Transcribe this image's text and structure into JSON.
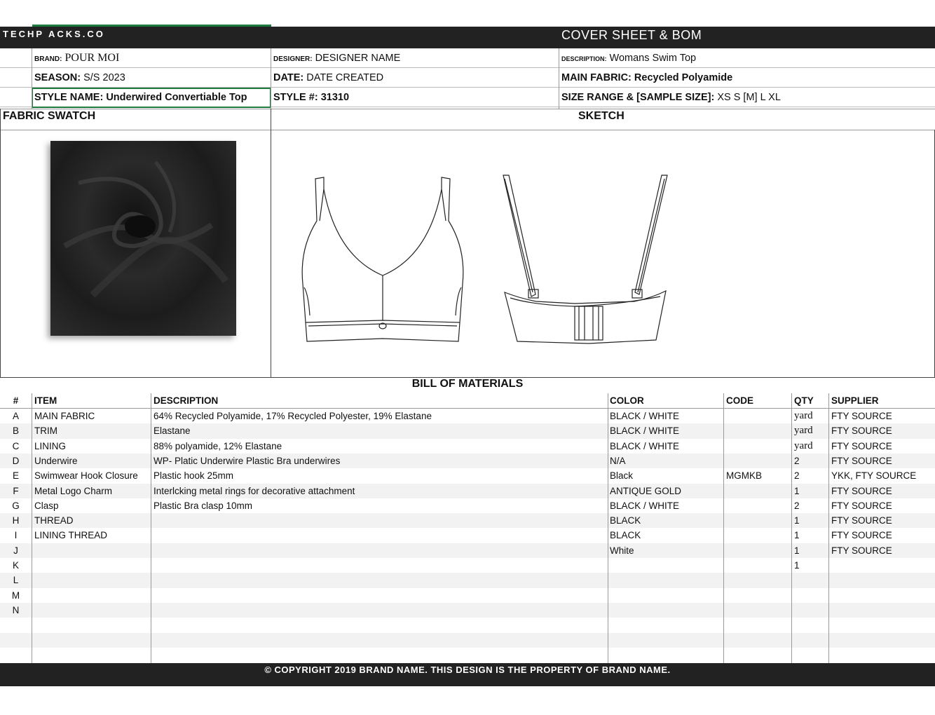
{
  "header": {
    "logo": "TECHP ACKS.CO",
    "title": "COVER  SHEET  &  BOM"
  },
  "info": {
    "brand_label": "BRAND:",
    "brand": "POUR MOI",
    "designer_label": "DESIGNER:",
    "designer": "DESIGNER NAME",
    "description_label": "DESCRIPTION:",
    "description": "Womans Swim Top",
    "season_label": "SEASON:",
    "season": "S/S 2023",
    "date_label": "DATE:",
    "date": "DATE CREATED",
    "main_fabric_label": "MAIN FABRIC:",
    "main_fabric": "Recycled Polyamide",
    "style_name_label": "STYLE NAME:",
    "style_name": "Underwired Convertiable Top",
    "style_no_label": "STYLE #:",
    "style_no": "31310",
    "size_range_label": "SIZE RANGE & [SAMPLE SIZE]:",
    "size_range": "XS  S  [M]  L  XL"
  },
  "sections": {
    "fabric_swatch": "FABRIC SWATCH",
    "sketch": "SKETCH"
  },
  "bom": {
    "title": "BILL OF MATERIALS",
    "columns": [
      "#",
      "ITEM",
      "DESCRIPTION",
      "COLOR",
      "CODE",
      "QTY",
      "SUPPLIER"
    ],
    "rows": [
      {
        "id": "A",
        "item": "MAIN FABRIC",
        "desc": "64% Recycled Polyamide, 17% Recycled Polyester, 19% Elastane",
        "color": "BLACK / WHITE",
        "code": "",
        "qty": "yard",
        "supplier": "FTY SOURCE"
      },
      {
        "id": "B",
        "item": "TRIM",
        "desc": "Elastane",
        "color": "BLACK / WHITE",
        "code": "",
        "qty": "yard",
        "supplier": "FTY SOURCE"
      },
      {
        "id": "C",
        "item": "LINING",
        "desc": "88% polyamide, 12% Elastane",
        "color": "BLACK / WHITE",
        "code": "",
        "qty": "yard",
        "supplier": "FTY SOURCE"
      },
      {
        "id": "D",
        "item": "Underwire",
        "desc": "WP- Platic Underwire Plastic Bra underwires",
        "color": "N/A",
        "code": "",
        "qty": "2",
        "supplier": "FTY SOURCE"
      },
      {
        "id": "E",
        "item": "Swimwear Hook Closure",
        "desc": "Plastic hook  25mm",
        "color": "Black",
        "code": "MGMKB",
        "qty": "2",
        "supplier": "YKK, FTY SOURCE"
      },
      {
        "id": "F",
        "item": "Metal Logo Charm",
        "desc": "Interlcking metal rings for decorative attachment",
        "color": "ANTIQUE GOLD",
        "code": "",
        "qty": "1",
        "supplier": "FTY SOURCE"
      },
      {
        "id": "G",
        "item": "Clasp",
        "desc": "Plastic Bra clasp 10mm",
        "color": "BLACK / WHITE",
        "code": "",
        "qty": "2",
        "supplier": "FTY SOURCE"
      },
      {
        "id": "H",
        "item": "THREAD",
        "desc": "",
        "color": "BLACK",
        "code": "",
        "qty": "1",
        "supplier": "FTY SOURCE"
      },
      {
        "id": "I",
        "item": "LINING THREAD",
        "desc": "",
        "color": "BLACK",
        "code": "",
        "qty": "1",
        "supplier": "FTY SOURCE"
      },
      {
        "id": "J",
        "item": "",
        "desc": "",
        "color": "White",
        "code": "",
        "qty": "1",
        "supplier": "FTY SOURCE"
      },
      {
        "id": "K",
        "item": "",
        "desc": "",
        "color": "",
        "code": "",
        "qty": "1",
        "supplier": ""
      },
      {
        "id": "L",
        "item": "",
        "desc": "",
        "color": "",
        "code": "",
        "qty": "",
        "supplier": ""
      },
      {
        "id": "M",
        "item": "",
        "desc": "",
        "color": "",
        "code": "",
        "qty": "",
        "supplier": ""
      },
      {
        "id": "N",
        "item": "",
        "desc": "",
        "color": "",
        "code": "",
        "qty": "",
        "supplier": ""
      },
      {
        "id": "",
        "item": "",
        "desc": "",
        "color": "",
        "code": "",
        "qty": "",
        "supplier": ""
      },
      {
        "id": "",
        "item": "",
        "desc": "",
        "color": "",
        "code": "",
        "qty": "",
        "supplier": ""
      },
      {
        "id": "",
        "item": "",
        "desc": "",
        "color": "",
        "code": "",
        "qty": "",
        "supplier": ""
      }
    ]
  },
  "footer": "© COPYRIGHT 2019 BRAND NAME.  THIS DESIGN IS THE PROPERTY OF BRAND NAME."
}
